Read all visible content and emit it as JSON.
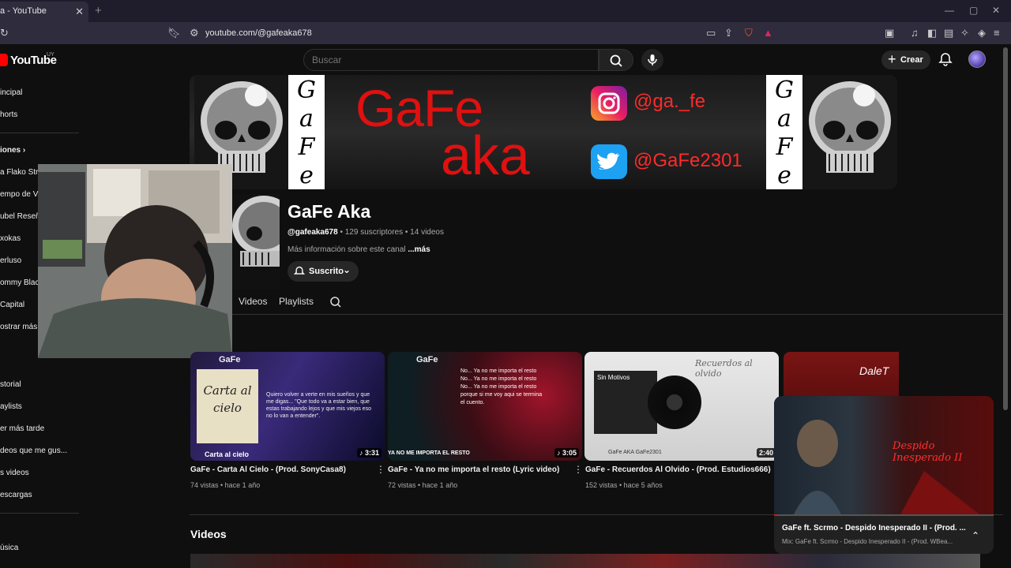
{
  "browser": {
    "tab_title": "a - YouTube",
    "tab_close": "✕",
    "new_tab": "+",
    "url": "youtube.com/@gafeaka678"
  },
  "header": {
    "logo_text": "YouTube",
    "region": "UY",
    "search_placeholder": "Buscar",
    "create_label": "Crear"
  },
  "sidebar": {
    "items_top": [
      "incipal",
      "horts"
    ],
    "subs_header": "iones",
    "subs": [
      "a Flako Strike",
      "empo de Vi",
      "ubel Reseñ",
      "xokas",
      "erluso",
      "ommy Black",
      "Capital",
      "ostrar más"
    ],
    "items_you": [
      "storial",
      "aylists",
      "er más tarde",
      "deos que me gus...",
      "s videos",
      "escargas"
    ],
    "items_bottom": [
      "úsica"
    ]
  },
  "banner": {
    "title_line1": "GaFe",
    "title_line2": "aka",
    "side_letters": [
      "G",
      "a",
      "F",
      "e"
    ],
    "instagram_handle": "@ga._fe",
    "twitter_handle": "@GaFe2301"
  },
  "channel": {
    "name": "GaFe Aka",
    "handle": "@gafeaka678",
    "meta": " • 129 suscriptores • 14 videos",
    "about": "Más información sobre este canal",
    "more": "...más",
    "subscribe_label": "Suscrito"
  },
  "tabs": [
    "Videos",
    "Playlists"
  ],
  "videos": [
    {
      "title": "GaFe - Carta Al Cielo - (Prod. SonyCasa8)",
      "meta": "74 vistas • hace 1 año",
      "duration": "3:31",
      "thumb_label": "GaFe",
      "thumb_card": "Carta al cielo",
      "thumb_bottom": "Carta al cielo",
      "thumb_lyrics": "Quiero volver a verte en mis sueños y que me digas... \"Que todo va a estar bien, que estas trabajando lejos y que mis viejos eso no lo van a entender\"."
    },
    {
      "title": "GaFe - Ya no me importa el resto (Lyric video)",
      "meta": "72 vistas • hace 1 año",
      "duration": "3:05",
      "thumb_label": "GaFe",
      "thumb_bottom": "YA NO ME IMPORTA EL RESTO",
      "thumb_lyrics": "No... Ya no me importa el resto No... Ya no me importa el resto No... Ya no me importa el resto porque si me voy aqui se termina el cuento."
    },
    {
      "title": "GaFe - Recuerdos Al Olvido - (Prod. Estudios666)",
      "meta": "152 vistas • hace 5 años",
      "duration": "2:40",
      "thumb_label": "Sin Motivos",
      "thumb_script": "Recuerdos al olvido",
      "thumb_footer": "GaFe AKA   GaFe2301"
    },
    {
      "thumb_label": "DaleT"
    }
  ],
  "section_videos": "Videos",
  "miniplayer": {
    "title": "GaFe ft. Scrmo - Despido Inesperado II - (Prod. ...",
    "subtitle": "Mix: GaFe ft. Scrmo - Despido Inesperado II - (Prod. WBea...",
    "overlay_text": "Despido Inesperado II"
  },
  "colors": {
    "youtube_red": "#ff0000",
    "banner_red": "#e01010",
    "background": "#0f0f0f"
  }
}
